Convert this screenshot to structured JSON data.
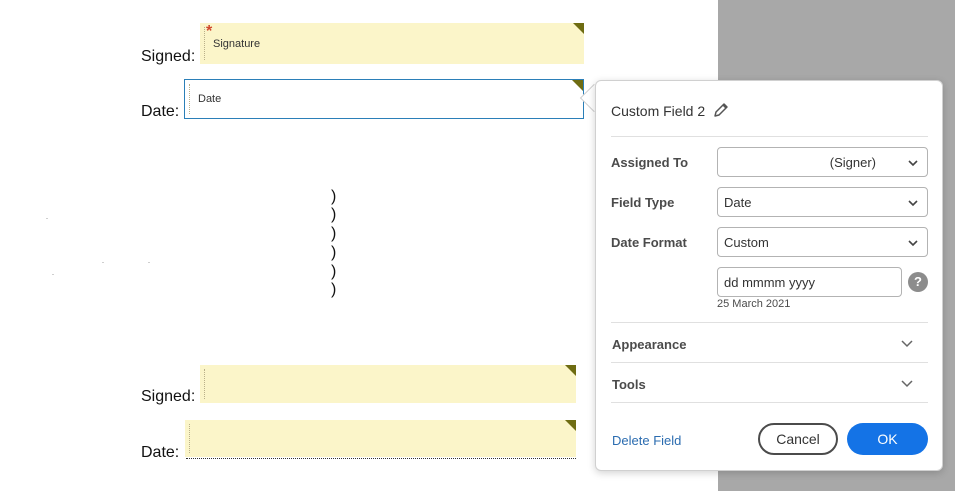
{
  "document": {
    "signed_label": "Signed:",
    "date_label": "Date:",
    "signature_field_text": "Signature",
    "date_field_text": "Date",
    "required_marker": "*",
    "parens": [
      ")",
      ")",
      ")",
      ")",
      ")",
      ")"
    ],
    "signed_label_2": "Signed:",
    "date_label_2": "Date:"
  },
  "panel": {
    "title": "Custom Field 2",
    "assigned_to": {
      "label": "Assigned To",
      "value": "(Signer)"
    },
    "field_type": {
      "label": "Field Type",
      "value": "Date"
    },
    "date_format": {
      "label": "Date Format",
      "value": "Custom",
      "custom_input": "dd mmmm yyyy",
      "preview": "25 March 2021",
      "help": "?"
    },
    "sections": {
      "appearance": "Appearance",
      "tools": "Tools"
    },
    "delete_link": "Delete Field",
    "cancel_label": "Cancel",
    "ok_label": "OK"
  },
  "colors": {
    "field_fill": "#fbf5c9",
    "corner_marker": "#6e6c12",
    "selected_border": "#2b7fb8",
    "primary_button": "#1473e6",
    "link": "#2b6cb0",
    "side_gray": "#a8a8a8"
  },
  "icons": [
    "pencil-icon",
    "chevron-down-icon",
    "help-icon"
  ]
}
